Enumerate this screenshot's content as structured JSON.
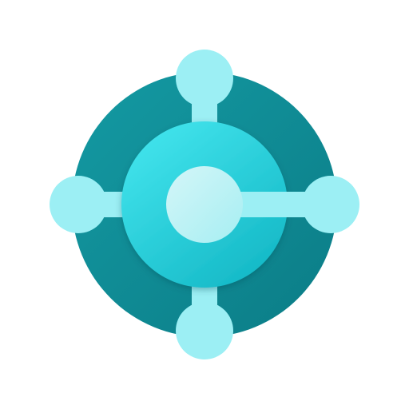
{
  "app_icon": {
    "name": "business-central-logo-icon",
    "colors": {
      "background": "#ffffff",
      "outer_ring_dark": "#0b7c86",
      "outer_ring_light": "#149aa3",
      "inner_disc_light": "#3fe1ea",
      "inner_disc_dark": "#14b8c6",
      "node": "#9ceff4",
      "node_shadow": "#63cfd9",
      "center_dot_light": "#d4f6f8",
      "center_dot_dark": "#a6eef2",
      "connector": "#9ceff4"
    }
  }
}
